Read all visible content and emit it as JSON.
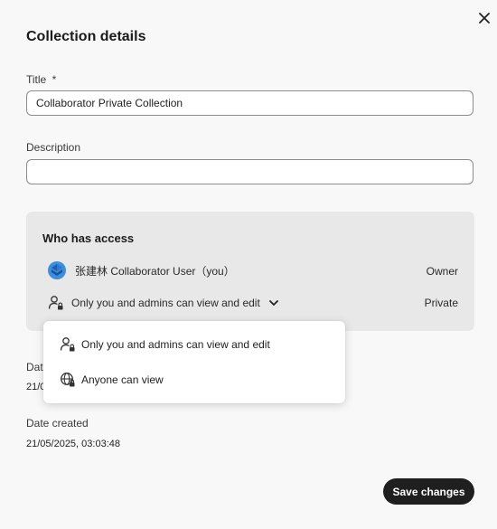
{
  "dialog": {
    "title": "Collection details",
    "close_icon": "close-icon"
  },
  "form": {
    "title_label": "Title",
    "title_required": "*",
    "title_value": "Collaborator Private Collection",
    "description_label": "Description",
    "description_value": ""
  },
  "access": {
    "heading": "Who has access",
    "owner": {
      "name": "张建林 Collaborator User（you）",
      "role": "Owner",
      "avatar_icon": "user-avatar-icon"
    },
    "permission": {
      "selected": "Only you and admins can view and edit",
      "visibility": "Private",
      "icon": "person-lock-icon"
    }
  },
  "dropdown": {
    "options": [
      {
        "label": "Only you and admins can view and edit",
        "icon": "person-lock-icon"
      },
      {
        "label": "Anyone can view",
        "icon": "globe-icon"
      }
    ]
  },
  "dates": {
    "modified_label": "Date modified",
    "modified_value": "21/05/2025, 03:03:48",
    "created_label": "Date created",
    "created_value": "21/05/2025, 03:03:48"
  },
  "footer": {
    "save_label": "Save changes"
  }
}
